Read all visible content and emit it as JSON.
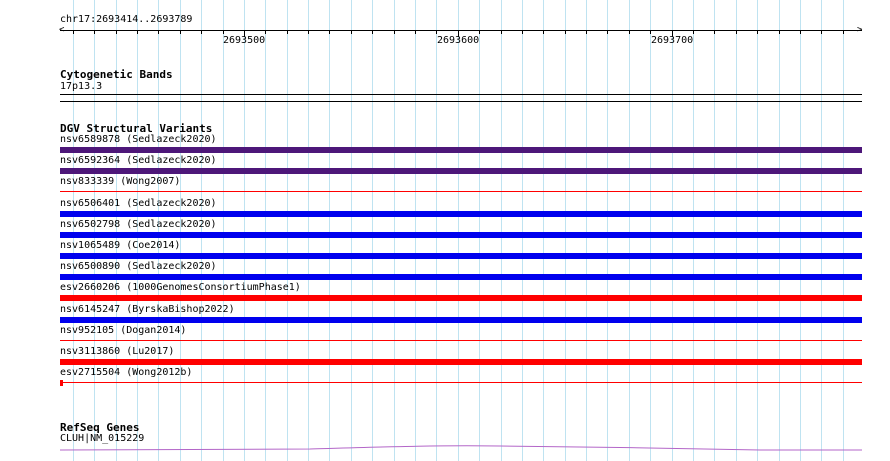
{
  "colors": {
    "grid": "#bfe3f1",
    "purple": "#4d1779",
    "blue": "#0000ee",
    "red": "#ff0000",
    "refseq": "#b366c8"
  },
  "ruler": {
    "coordinates": "chr17:2693414..2693789",
    "start": 2693414,
    "end": 2693789,
    "tick_labels": [
      "2693500",
      "2693600",
      "2693700"
    ],
    "left_arrow": "<",
    "right_arrow": ">"
  },
  "cytobands": {
    "title": "Cytogenetic Bands",
    "band": "17p13.3"
  },
  "dgv": {
    "title": "DGV Structural Variants",
    "variants": [
      {
        "label": "nsv6589878 (Sedlazeck2020)",
        "color": "purple",
        "style": "thick"
      },
      {
        "label": "nsv6592364 (Sedlazeck2020)",
        "color": "purple",
        "style": "thick"
      },
      {
        "label": "nsv833339 (Wong2007)",
        "color": "red",
        "style": "thin"
      },
      {
        "label": "nsv6506401 (Sedlazeck2020)",
        "color": "blue",
        "style": "thick"
      },
      {
        "label": "nsv6502798 (Sedlazeck2020)",
        "color": "blue",
        "style": "thick"
      },
      {
        "label": "nsv1065489 (Coe2014)",
        "color": "blue",
        "style": "thick"
      },
      {
        "label": "nsv6500890 (Sedlazeck2020)",
        "color": "blue",
        "style": "thick"
      },
      {
        "label": "esv2660206 (1000GenomesConsortiumPhase1)",
        "color": "red",
        "style": "thick"
      },
      {
        "label": "nsv6145247 (ByrskaBishop2022)",
        "color": "blue",
        "style": "thick"
      },
      {
        "label": "nsv952105 (Dogan2014)",
        "color": "red",
        "style": "thin"
      },
      {
        "label": "nsv3113860 (Lu2017)",
        "color": "red",
        "style": "thick"
      },
      {
        "label": "esv2715504 (Wong2012b)",
        "color": "red",
        "style": "thin",
        "start_mark": true
      }
    ]
  },
  "refseq": {
    "title": "RefSeq Genes",
    "gene": "CLUH|NM_015229"
  }
}
